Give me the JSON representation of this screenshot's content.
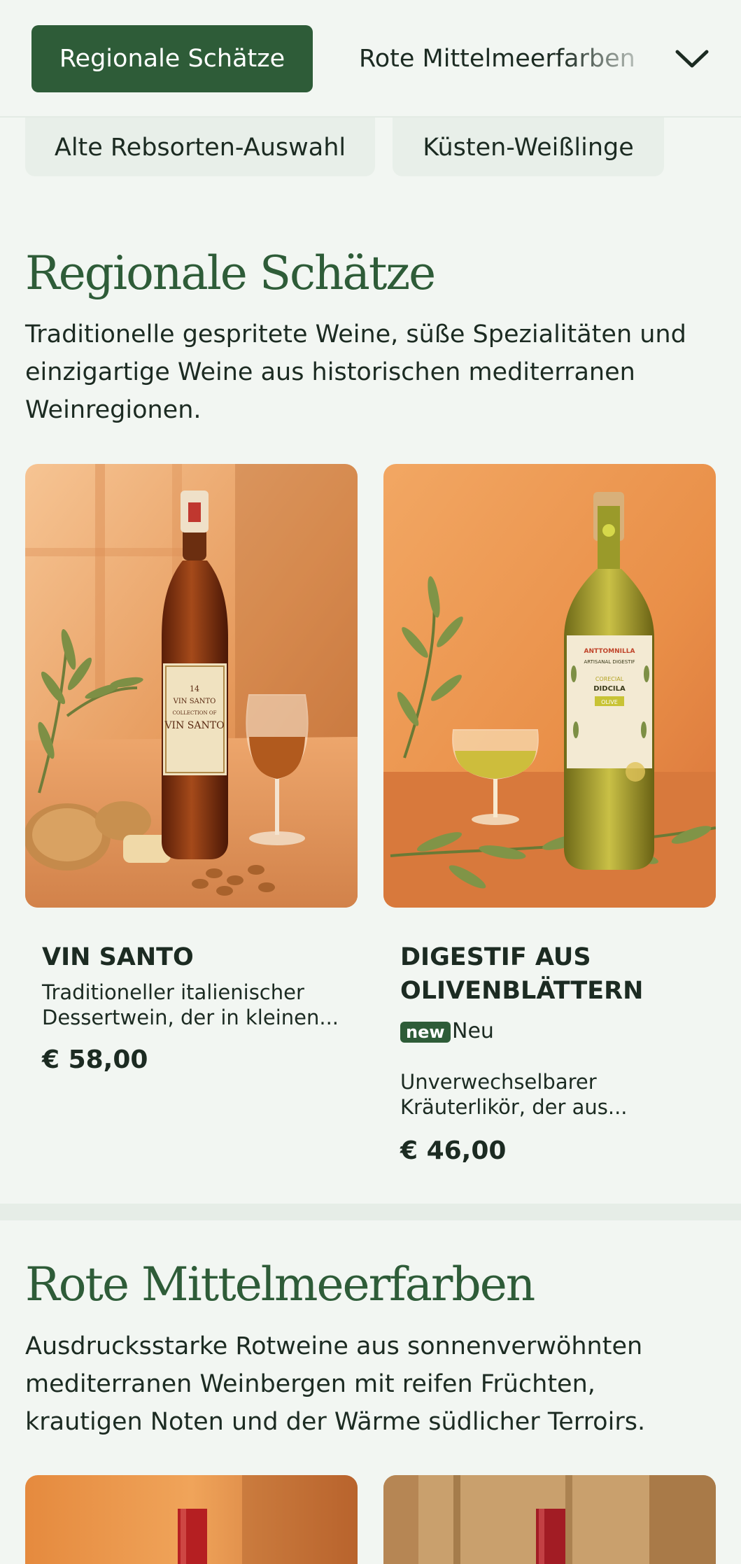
{
  "nav": {
    "active_tab": "Regionale Schätze",
    "next_tab": "Rote Mittelmeerfarben",
    "chips": [
      "Alte Rebsorten-Auswahl",
      "Küsten-Weißlinge"
    ]
  },
  "section1": {
    "title": "Regionale Schätze",
    "description": "Traditionelle gespritete Weine, süße Spezialitäten und einzigartige Weine aus historischen mediterranen Weinregionen.",
    "products": [
      {
        "name": "VIN SANTO",
        "description": "Traditioneller italienischer Dessertwein, der in kleinen...",
        "price": "€ 58,00",
        "label_lines": [
          "14",
          "VIN SANTO",
          "COLLECTION OF",
          "VIN SANTO"
        ]
      },
      {
        "name": "DIGESTIF AUS OLIVENBLÄTTERN",
        "badge": "new",
        "badge_text": "Neu",
        "description": "Unverwechselbarer Kräuterlikör, der aus...",
        "price": "€ 46,00",
        "label_lines": [
          "ANTTOMNILLA",
          "ARTISANAL DIGESTIF",
          "CORECIAL",
          "DIDCILA",
          "OLIVE"
        ]
      }
    ]
  },
  "section2": {
    "title": "Rote Mittelmeerfarben",
    "description": "Ausdrucksstarke Rotweine aus sonnenverwöhnten mediterranen Weinbergen mit reifen Früchten, krautigen Noten und der Wärme südlicher Terroirs."
  },
  "colors": {
    "brand_green": "#2e5c38",
    "background": "#f2f6f2",
    "chip_bg": "#e8efe9"
  },
  "icons": [
    "chevron-down-icon"
  ]
}
